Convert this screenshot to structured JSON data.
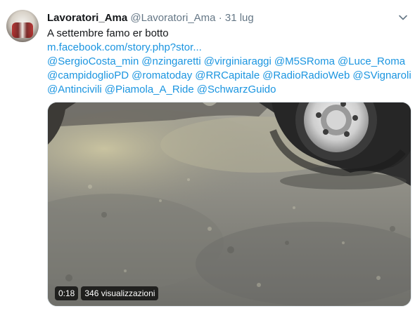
{
  "tweet": {
    "display_name": "Lavoratori_Ama",
    "handle": "@Lavoratori_Ama",
    "separator": "·",
    "date": "31 lug",
    "text": "A settembre famo er botto",
    "link": "m.facebook.com/story.php?stor...",
    "mentions_line1": [
      "@SergioCosta_min",
      "@nzingaretti",
      "@virginiaraggi",
      "@M5SRoma",
      "@Luce_Roma"
    ],
    "mentions_line2": [
      "@campidoglioPD",
      "@romatoday",
      "@RRCapitale",
      "@RadioRadioWeb",
      "@SVignaroli"
    ],
    "mentions_line3": [
      "@Antincivili",
      "@Piamola_A_Ride",
      "@SchwarzGuido"
    ]
  },
  "video": {
    "duration": "0:18",
    "views": "346 visualizzazioni"
  },
  "colors": {
    "link": "#1b95e0",
    "muted": "#657786",
    "text": "#14171a"
  },
  "icons": {
    "menu": "chevron-down-icon"
  }
}
